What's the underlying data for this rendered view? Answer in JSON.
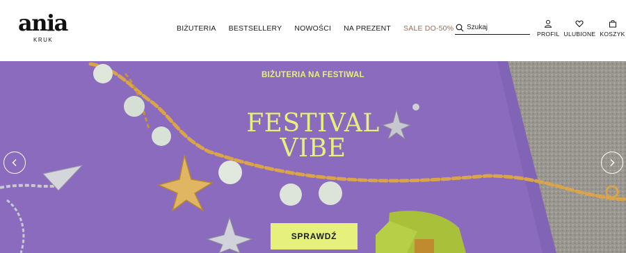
{
  "brand": {
    "name": "ania",
    "sub": "KRUK"
  },
  "nav": {
    "items": [
      {
        "label": "BIŻUTERIA"
      },
      {
        "label": "BESTSELLERY"
      },
      {
        "label": "NOWOŚCI"
      },
      {
        "label": "NA PREZENT"
      },
      {
        "label": "SALE DO-50%"
      }
    ]
  },
  "search": {
    "placeholder": "Szukaj",
    "value": ""
  },
  "actions": {
    "profile": "PROFIL",
    "favorites": "ULUBIONE",
    "cart": "KOSZYK"
  },
  "hero": {
    "kicker": "BIŻUTERIA NA FESTIWAL",
    "title_line1": "FESTIVAL",
    "title_line2": "VIBE",
    "cta": "SPRAWDŹ"
  },
  "colors": {
    "accent": "#e6f07c",
    "sale": "#a36a4b",
    "hero_bg": "#8b6cbf"
  }
}
